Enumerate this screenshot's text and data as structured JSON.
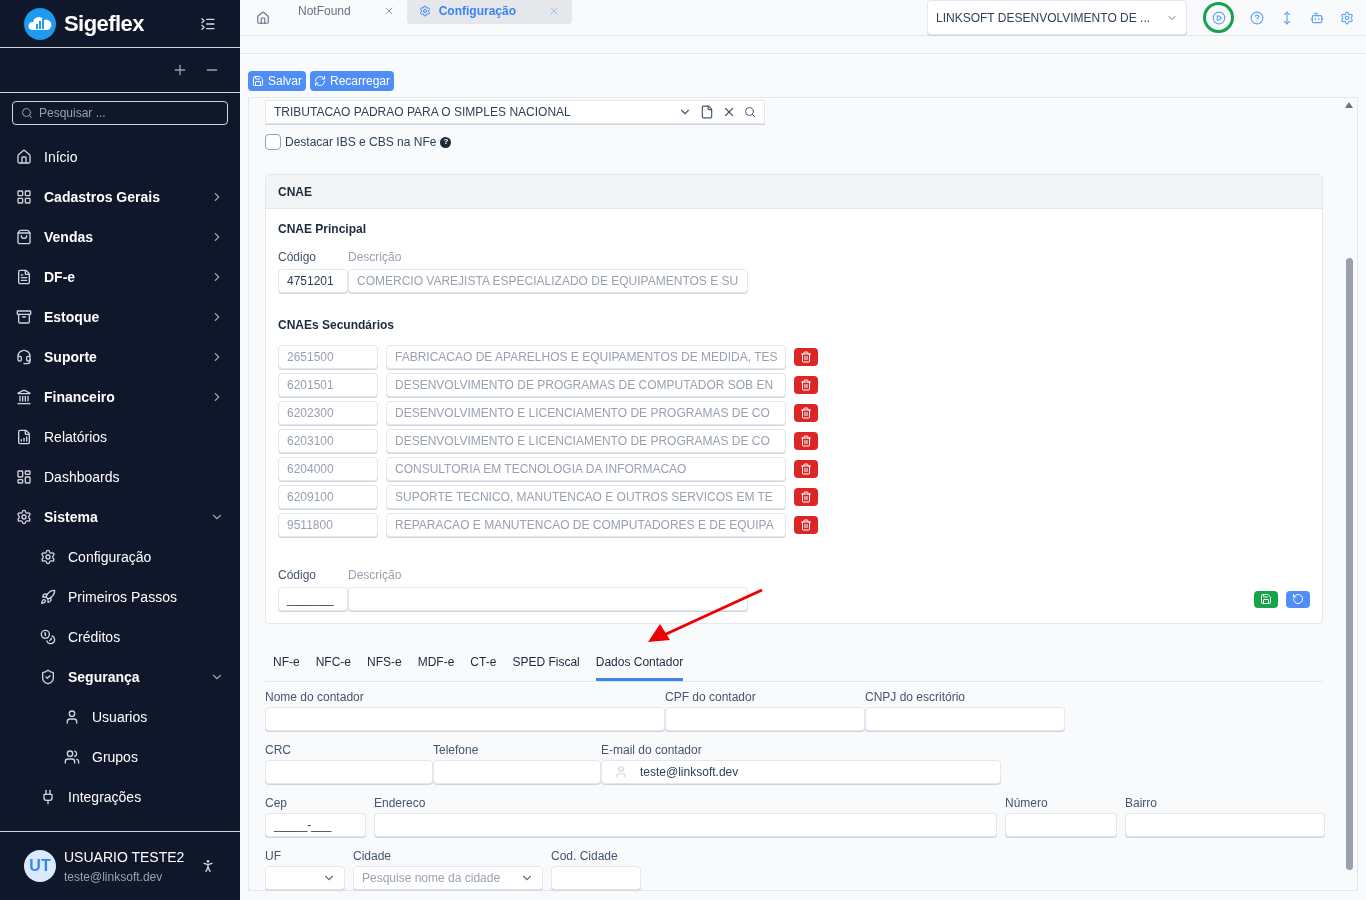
{
  "brand": {
    "name": "Sigeflex"
  },
  "sidebar": {
    "search": {
      "placeholder": "Pesquisar ..."
    },
    "items": [
      {
        "label": "Início"
      },
      {
        "label": "Cadastros Gerais",
        "expanded": false
      },
      {
        "label": "Vendas",
        "expanded": false
      },
      {
        "label": "DF-e",
        "expanded": false
      },
      {
        "label": "Estoque",
        "expanded": false
      },
      {
        "label": "Suporte",
        "expanded": false
      },
      {
        "label": "Financeiro",
        "expanded": false
      },
      {
        "label": "Relatórios"
      },
      {
        "label": "Dashboards"
      },
      {
        "label": "Sistema",
        "expanded": true,
        "children": [
          {
            "label": "Configuração"
          },
          {
            "label": "Primeiros Passos"
          },
          {
            "label": "Créditos"
          },
          {
            "label": "Segurança",
            "expanded": true,
            "children": [
              {
                "label": "Usuarios"
              },
              {
                "label": "Grupos"
              }
            ]
          },
          {
            "label": "Integrações"
          }
        ]
      }
    ],
    "user": {
      "initials": "UT",
      "name": "USUARIO TESTE2",
      "email": "teste@linksoft.dev"
    }
  },
  "tabs": [
    {
      "label": "NotFound",
      "selected": false
    },
    {
      "label": "Configuração",
      "selected": true
    }
  ],
  "company_select": {
    "value": "LINKSOFT DESENVOLVIMENTO DE ..."
  },
  "toolbar": {
    "buttons": [
      "Salvar",
      "Recarregar"
    ]
  },
  "tax_profile": {
    "value": "TRIBUTACAO PADRAO PARA O SIMPLES NACIONAL"
  },
  "highlight_option": {
    "label": "Destacar IBS e CBS na NFe",
    "checked": false,
    "help": "?"
  },
  "cnae": {
    "title": "CNAE",
    "principal": {
      "title": "CNAE Principal",
      "code_label": "Código",
      "description_label": "Descrição",
      "code": "4751201",
      "description": "COMERCIO VAREJISTA ESPECIALIZADO DE EQUIPAMENTOS E SU"
    },
    "secondary_title": "CNAEs Secundários",
    "secondary": [
      {
        "code": "2651500",
        "description": "FABRICACAO DE APARELHOS E EQUIPAMENTOS DE MEDIDA, TES"
      },
      {
        "code": "6201501",
        "description": "DESENVOLVIMENTO DE PROGRAMAS DE COMPUTADOR SOB EN"
      },
      {
        "code": "6202300",
        "description": "DESENVOLVIMENTO E LICENCIAMENTO DE PROGRAMAS DE CO"
      },
      {
        "code": "6203100",
        "description": "DESENVOLVIMENTO E LICENCIAMENTO DE PROGRAMAS DE CO"
      },
      {
        "code": "6204000",
        "description": "CONSULTORIA EM TECNOLOGIA DA INFORMACAO"
      },
      {
        "code": "6209100",
        "description": "SUPORTE TECNICO, MANUTENCAO E OUTROS SERVICOS EM TE"
      },
      {
        "code": "9511800",
        "description": "REPARACAO E MANUTENCAO DE COMPUTADORES E DE EQUIPA"
      }
    ],
    "new": {
      "code_label": "Código",
      "description_label": "Descrição",
      "code": "_______"
    }
  },
  "doc_tabs": [
    {
      "label": "NF-e",
      "selected": false
    },
    {
      "label": "NFC-e",
      "selected": false
    },
    {
      "label": "NFS-e",
      "selected": false
    },
    {
      "label": "MDF-e",
      "selected": false
    },
    {
      "label": "CT-e",
      "selected": false
    },
    {
      "label": "SPED Fiscal",
      "selected": false
    },
    {
      "label": "Dados Contador",
      "selected": true
    }
  ],
  "accountant_form": [
    [
      {
        "kind": "text",
        "label": "Nome do contador"
      },
      {
        "kind": "text",
        "label": "CPF do contador"
      },
      {
        "kind": "text",
        "label": "CNPJ do escritório"
      }
    ],
    [
      {
        "kind": "text",
        "label": "CRC"
      },
      {
        "kind": "text",
        "label": "Telefone"
      },
      {
        "kind": "email",
        "label": "E-mail do contador",
        "value": "teste@linksoft.dev"
      }
    ],
    [
      {
        "kind": "text",
        "label": "Cep",
        "value": "_____-___"
      },
      {
        "kind": "text",
        "label": "Endereco"
      },
      {
        "kind": "text",
        "label": "Número"
      },
      {
        "kind": "text",
        "label": "Bairro"
      }
    ],
    [
      {
        "kind": "select",
        "label": "UF"
      },
      {
        "kind": "select",
        "label": "Cidade",
        "placeholder": "Pesquise nome da cidade"
      },
      {
        "kind": "text",
        "label": "Cod. Cidade"
      }
    ]
  ]
}
